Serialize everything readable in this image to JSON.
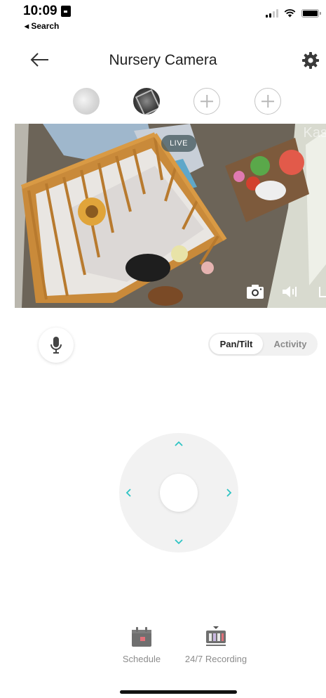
{
  "status_bar": {
    "time": "10:09",
    "back_label": "◂ Search",
    "battery_level": 1.0
  },
  "header": {
    "title": "Nursery Camera",
    "back_icon": "back-arrow-icon",
    "settings_icon": "gear-icon"
  },
  "camera_selector": {
    "cameras": [
      "camera-thumb-1",
      "camera-thumb-2"
    ],
    "add_slots": 2
  },
  "video": {
    "live_label": "LIVE",
    "watermark": "Kas",
    "controls": [
      "camera-snapshot-icon",
      "volume-icon",
      "fullscreen-icon"
    ]
  },
  "controls": {
    "mic_icon": "microphone-icon",
    "tabs": [
      {
        "label": "Pan/Tilt",
        "active": true
      },
      {
        "label": "Activity",
        "active": false
      }
    ]
  },
  "joystick": {
    "directions": [
      "up",
      "down",
      "left",
      "right"
    ],
    "accent": "#2ec4c4"
  },
  "shortcuts": [
    {
      "label": "Schedule",
      "icon": "calendar-icon"
    },
    {
      "label": "24/7 Recording",
      "icon": "recording-icon"
    }
  ],
  "colors": {
    "accent": "#2ec4c4",
    "muted_text": "#8c8c8c",
    "icon_gray": "#6f6f6f"
  }
}
